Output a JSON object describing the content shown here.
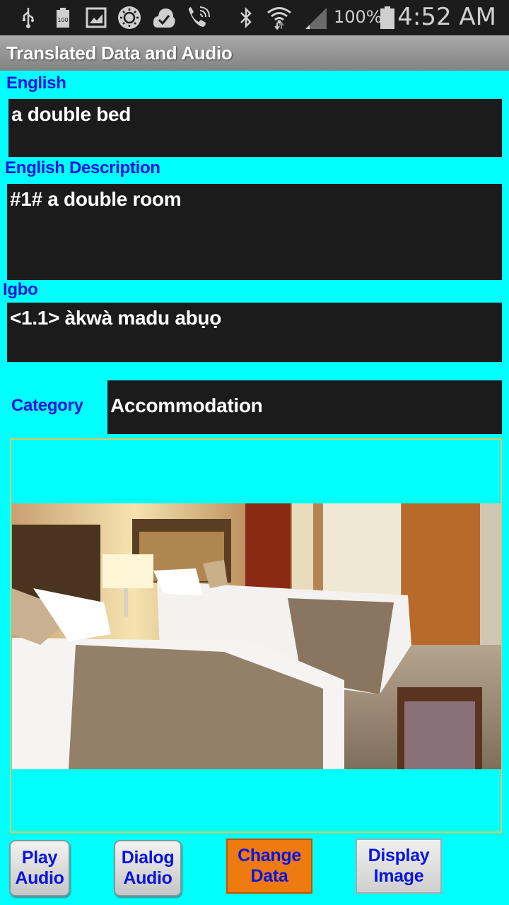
{
  "status_bar": {
    "icons": [
      "usb-icon",
      "battery-100-icon",
      "gallery-icon",
      "brightness-icon",
      "cloud-check-icon",
      "wifi-calling-icon",
      "bluetooth-icon",
      "wifi-icon",
      "signal-icon",
      "battery-icon"
    ],
    "battery_level_text": "100",
    "battery_percent": "100%",
    "time": "4:52 AM"
  },
  "title_bar": {
    "title": "Translated Data and Audio"
  },
  "fields": {
    "english": {
      "label": "English",
      "value": "a double bed"
    },
    "english_description": {
      "label": "English Description",
      "value": "#1# a double room"
    },
    "igbo": {
      "label": "Igbo",
      "value": "<1.1> àkwà madu abụọ"
    },
    "category": {
      "label": "Category",
      "value": "Accommodation"
    }
  },
  "image": {
    "description": "hotel room with two double beds"
  },
  "buttons": {
    "play_audio": "Play Audio",
    "dialog_audio": "Dialog Audio",
    "change_data": "Change Data",
    "display_image": "Display Image"
  },
  "colors": {
    "background": "#00ffff",
    "label_text": "#0a14e0",
    "field_bg": "#1b1b1b",
    "change_button": "#ee7a10"
  }
}
